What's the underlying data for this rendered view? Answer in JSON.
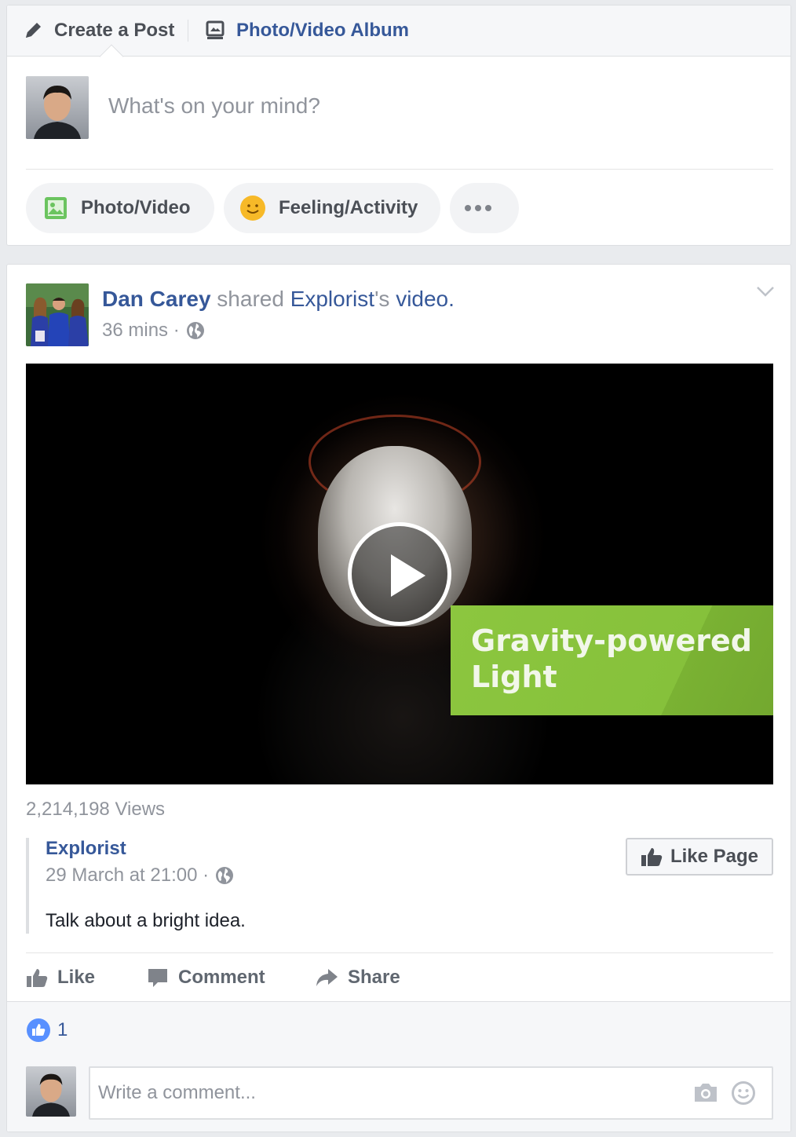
{
  "composer": {
    "tab_create": "Create a Post",
    "tab_album": "Photo/Video Album",
    "placeholder": "What's on your mind?",
    "pill_photo": "Photo/Video",
    "pill_feeling": "Feeling/Activity",
    "pill_more": "•••"
  },
  "post": {
    "author": "Dan Carey",
    "verb": " shared ",
    "page": "Explorist",
    "possessive": "'s ",
    "object": "video",
    "period": ".",
    "time": "36 mins ·",
    "video_caption_line1": "Gravity-powered",
    "video_caption_line2": "Light",
    "views": "2,214,198 Views",
    "shared": {
      "name": "Explorist",
      "meta": "29 March at 21:00 ·",
      "text": "Talk about a bright idea.",
      "like_page": "Like Page"
    },
    "actions": {
      "like": "Like",
      "comment": "Comment",
      "share": "Share"
    },
    "reactions_count": "1",
    "comment_placeholder": "Write a comment..."
  },
  "colors": {
    "link": "#365899",
    "muted": "#90949c",
    "background": "#e9ebee",
    "banner_green": "#8cc63f",
    "like_blue": "#5890ff"
  }
}
